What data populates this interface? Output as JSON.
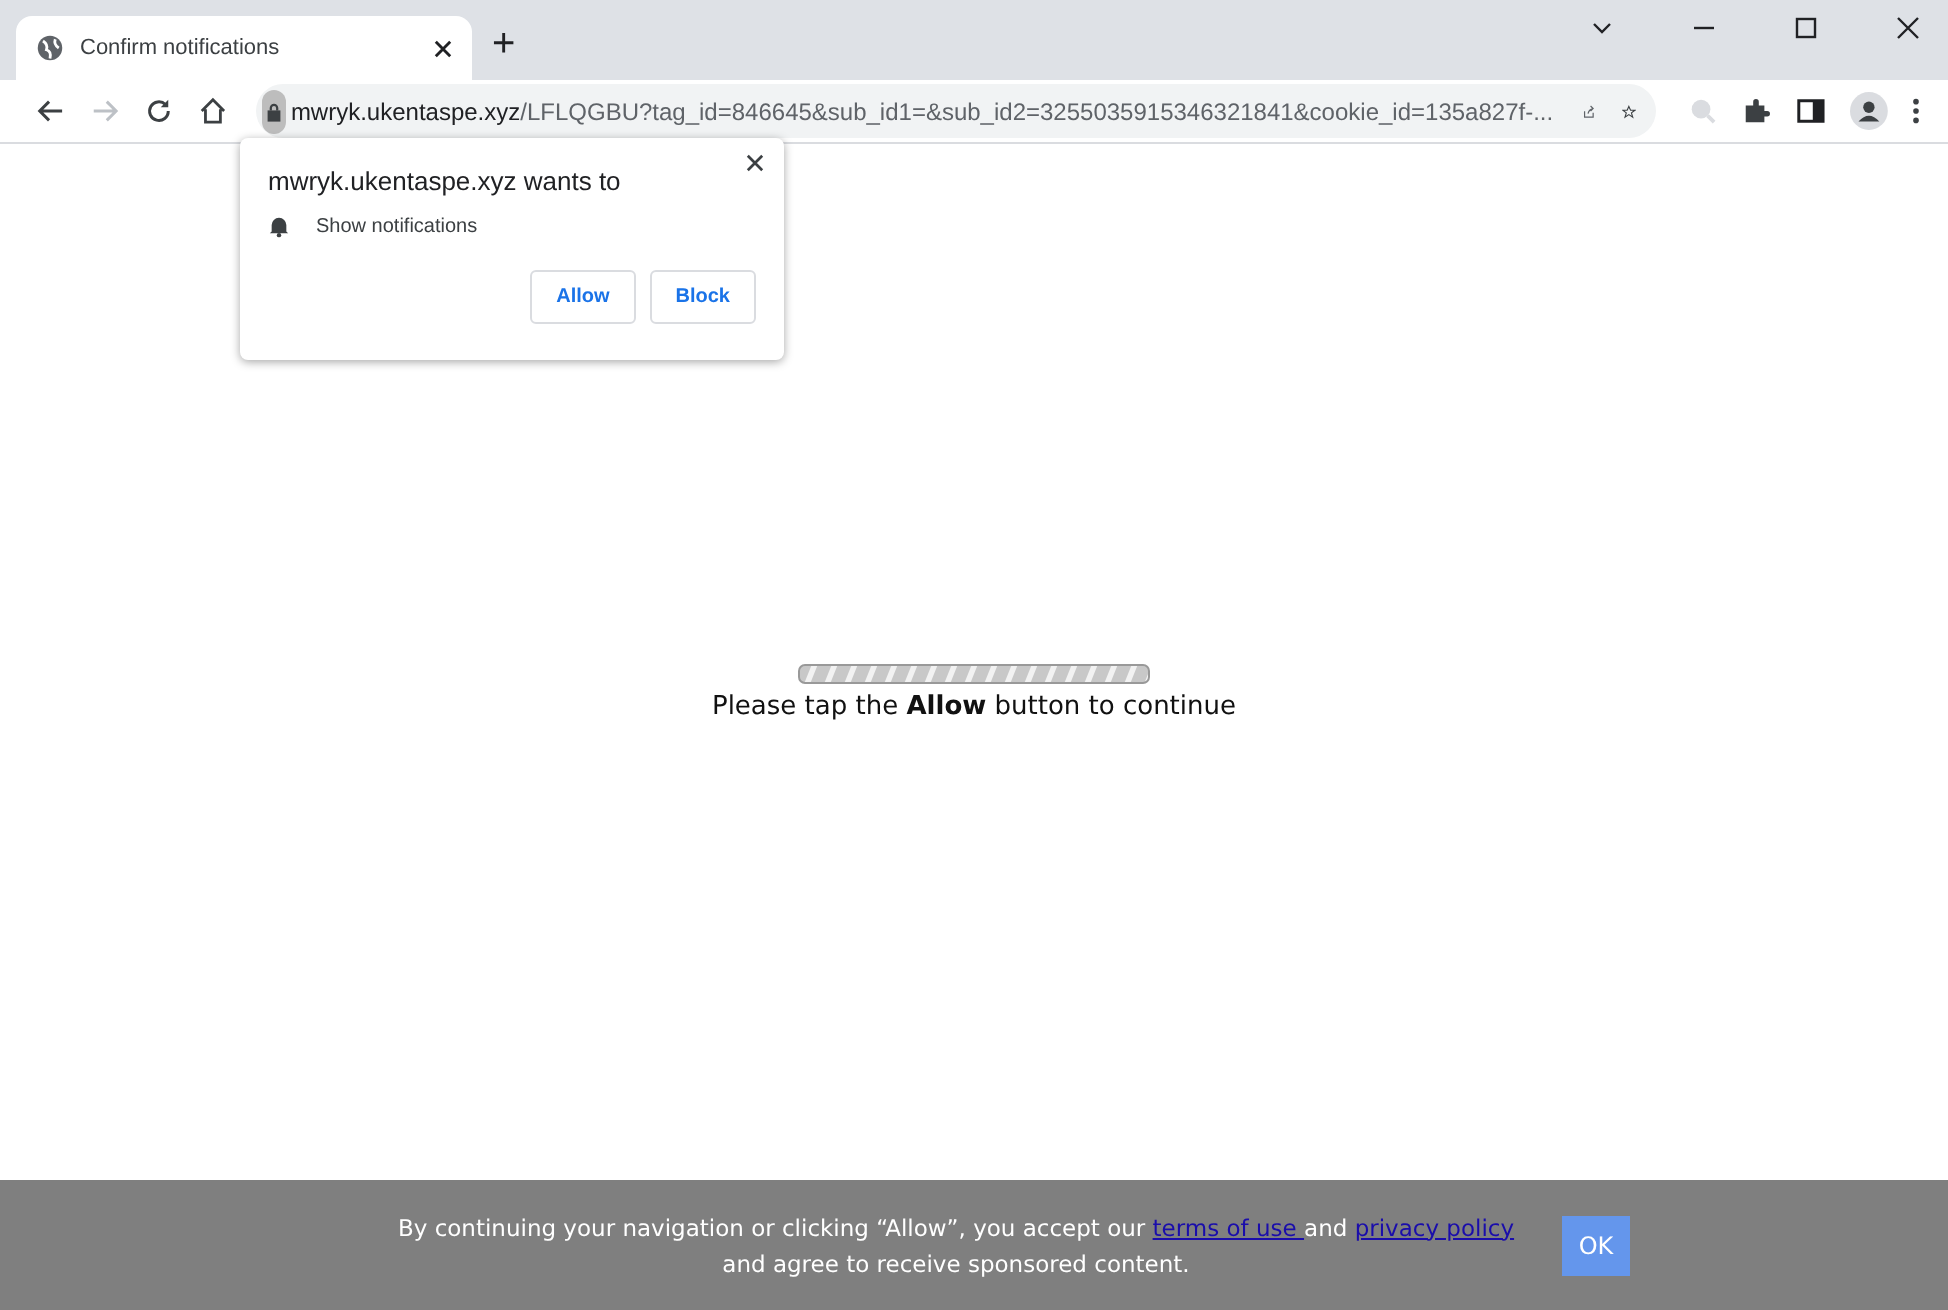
{
  "tabs": [
    {
      "title": "Confirm notifications",
      "selected": true
    }
  ],
  "new_tab": "+",
  "address_bar": {
    "host": "mwryk.ukentaspe.xyz",
    "path": "/LFLQGBU?tag_id=846645&sub_id1=&sub_id2=3255035915346321841&cookie_id=135a827f-..."
  },
  "permission_popup": {
    "title": "mwryk.ukentaspe.xyz wants to",
    "permission": "Show notifications",
    "buttons": [
      "Allow",
      "Block"
    ]
  },
  "page": {
    "message": "Please tap the **Allow** button to continue"
  },
  "consent_banner": {
    "text_before": "By continuing your navigation or clicking “Allow”, you accept our ",
    "terms_link": "terms of use ",
    "text_middle": "and ",
    "privacy_link": "privacy policy",
    "text_after": "and agree to receive sponsored content.",
    "ok_button": "OK"
  }
}
